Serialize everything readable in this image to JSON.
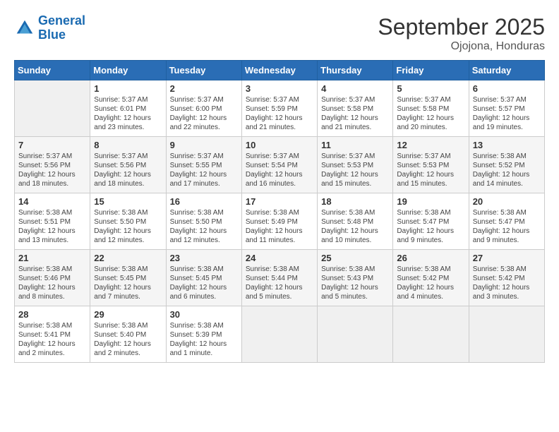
{
  "header": {
    "logo_line1": "General",
    "logo_line2": "Blue",
    "month": "September 2025",
    "location": "Ojojona, Honduras"
  },
  "days_of_week": [
    "Sunday",
    "Monday",
    "Tuesday",
    "Wednesday",
    "Thursday",
    "Friday",
    "Saturday"
  ],
  "weeks": [
    [
      {
        "day": "",
        "text": ""
      },
      {
        "day": "1",
        "text": "Sunrise: 5:37 AM\nSunset: 6:01 PM\nDaylight: 12 hours\nand 23 minutes."
      },
      {
        "day": "2",
        "text": "Sunrise: 5:37 AM\nSunset: 6:00 PM\nDaylight: 12 hours\nand 22 minutes."
      },
      {
        "day": "3",
        "text": "Sunrise: 5:37 AM\nSunset: 5:59 PM\nDaylight: 12 hours\nand 21 minutes."
      },
      {
        "day": "4",
        "text": "Sunrise: 5:37 AM\nSunset: 5:58 PM\nDaylight: 12 hours\nand 21 minutes."
      },
      {
        "day": "5",
        "text": "Sunrise: 5:37 AM\nSunset: 5:58 PM\nDaylight: 12 hours\nand 20 minutes."
      },
      {
        "day": "6",
        "text": "Sunrise: 5:37 AM\nSunset: 5:57 PM\nDaylight: 12 hours\nand 19 minutes."
      }
    ],
    [
      {
        "day": "7",
        "text": "Sunrise: 5:37 AM\nSunset: 5:56 PM\nDaylight: 12 hours\nand 18 minutes."
      },
      {
        "day": "8",
        "text": "Sunrise: 5:37 AM\nSunset: 5:56 PM\nDaylight: 12 hours\nand 18 minutes."
      },
      {
        "day": "9",
        "text": "Sunrise: 5:37 AM\nSunset: 5:55 PM\nDaylight: 12 hours\nand 17 minutes."
      },
      {
        "day": "10",
        "text": "Sunrise: 5:37 AM\nSunset: 5:54 PM\nDaylight: 12 hours\nand 16 minutes."
      },
      {
        "day": "11",
        "text": "Sunrise: 5:37 AM\nSunset: 5:53 PM\nDaylight: 12 hours\nand 15 minutes."
      },
      {
        "day": "12",
        "text": "Sunrise: 5:37 AM\nSunset: 5:53 PM\nDaylight: 12 hours\nand 15 minutes."
      },
      {
        "day": "13",
        "text": "Sunrise: 5:38 AM\nSunset: 5:52 PM\nDaylight: 12 hours\nand 14 minutes."
      }
    ],
    [
      {
        "day": "14",
        "text": "Sunrise: 5:38 AM\nSunset: 5:51 PM\nDaylight: 12 hours\nand 13 minutes."
      },
      {
        "day": "15",
        "text": "Sunrise: 5:38 AM\nSunset: 5:50 PM\nDaylight: 12 hours\nand 12 minutes."
      },
      {
        "day": "16",
        "text": "Sunrise: 5:38 AM\nSunset: 5:50 PM\nDaylight: 12 hours\nand 12 minutes."
      },
      {
        "day": "17",
        "text": "Sunrise: 5:38 AM\nSunset: 5:49 PM\nDaylight: 12 hours\nand 11 minutes."
      },
      {
        "day": "18",
        "text": "Sunrise: 5:38 AM\nSunset: 5:48 PM\nDaylight: 12 hours\nand 10 minutes."
      },
      {
        "day": "19",
        "text": "Sunrise: 5:38 AM\nSunset: 5:47 PM\nDaylight: 12 hours\nand 9 minutes."
      },
      {
        "day": "20",
        "text": "Sunrise: 5:38 AM\nSunset: 5:47 PM\nDaylight: 12 hours\nand 9 minutes."
      }
    ],
    [
      {
        "day": "21",
        "text": "Sunrise: 5:38 AM\nSunset: 5:46 PM\nDaylight: 12 hours\nand 8 minutes."
      },
      {
        "day": "22",
        "text": "Sunrise: 5:38 AM\nSunset: 5:45 PM\nDaylight: 12 hours\nand 7 minutes."
      },
      {
        "day": "23",
        "text": "Sunrise: 5:38 AM\nSunset: 5:45 PM\nDaylight: 12 hours\nand 6 minutes."
      },
      {
        "day": "24",
        "text": "Sunrise: 5:38 AM\nSunset: 5:44 PM\nDaylight: 12 hours\nand 5 minutes."
      },
      {
        "day": "25",
        "text": "Sunrise: 5:38 AM\nSunset: 5:43 PM\nDaylight: 12 hours\nand 5 minutes."
      },
      {
        "day": "26",
        "text": "Sunrise: 5:38 AM\nSunset: 5:42 PM\nDaylight: 12 hours\nand 4 minutes."
      },
      {
        "day": "27",
        "text": "Sunrise: 5:38 AM\nSunset: 5:42 PM\nDaylight: 12 hours\nand 3 minutes."
      }
    ],
    [
      {
        "day": "28",
        "text": "Sunrise: 5:38 AM\nSunset: 5:41 PM\nDaylight: 12 hours\nand 2 minutes."
      },
      {
        "day": "29",
        "text": "Sunrise: 5:38 AM\nSunset: 5:40 PM\nDaylight: 12 hours\nand 2 minutes."
      },
      {
        "day": "30",
        "text": "Sunrise: 5:38 AM\nSunset: 5:39 PM\nDaylight: 12 hours\nand 1 minute."
      },
      {
        "day": "",
        "text": ""
      },
      {
        "day": "",
        "text": ""
      },
      {
        "day": "",
        "text": ""
      },
      {
        "day": "",
        "text": ""
      }
    ]
  ]
}
